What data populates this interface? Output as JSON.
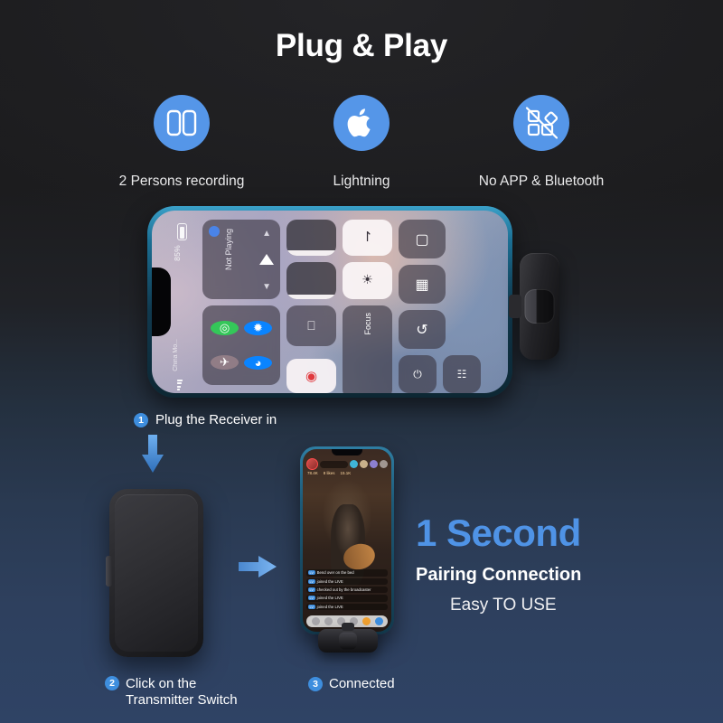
{
  "title": "Plug & Play",
  "colors": {
    "accent_blue": "#5596e8",
    "badge_blue": "#3e8ede",
    "headline_blue": "#4f93e6",
    "bg_top": "#1b1b1d",
    "bg_bottom": "#2f4365",
    "text_white": "#ffffff"
  },
  "features": [
    {
      "icon": "two-panels-icon",
      "label": "2 Persons recording"
    },
    {
      "icon": "apple-logo-icon",
      "label": "Lightning"
    },
    {
      "icon": "no-app-icon",
      "label": "No APP & Bluetooth"
    }
  ],
  "phone_control_center": {
    "battery_percent": "85%",
    "carrier": "China Mo...",
    "media_label": "Not Playing",
    "focus_label": "Focus",
    "tiles": [
      "airplay-icon",
      "screen-mirroring-icon",
      "rotation-lock-icon",
      "brightness-icon",
      "calculator-icon",
      "camera-icon",
      "timer-icon",
      "flashlight-icon",
      "qr-scanner-icon",
      "screen-record-icon"
    ],
    "toggles": [
      "cellular-icon",
      "bluetooth-icon",
      "airplane-icon",
      "wifi-icon"
    ]
  },
  "steps": [
    {
      "number": "1",
      "text": "Plug the Receiver in"
    },
    {
      "number": "2",
      "text_line1": "Click on the",
      "text_line2": "Transmitter Switch"
    },
    {
      "number": "3",
      "text": "Connected"
    }
  ],
  "headline": {
    "big": "1 Second",
    "mid": "Pairing Connection",
    "small": "Easy TO USE"
  },
  "phone_live": {
    "status_time": "",
    "stat_1": "78.4K",
    "stat_2": "8 likes",
    "stat_3": "15.1K",
    "chat": [
      "Bend over on the bed",
      "joined the LIVE",
      "checked out by the broadcaster",
      "joined the LIVE",
      "joined the LIVE"
    ],
    "chat_tag": "LV"
  },
  "devices": {
    "receiver_label": "receiver-dongle",
    "transmitter_label": "transmitter-box"
  }
}
